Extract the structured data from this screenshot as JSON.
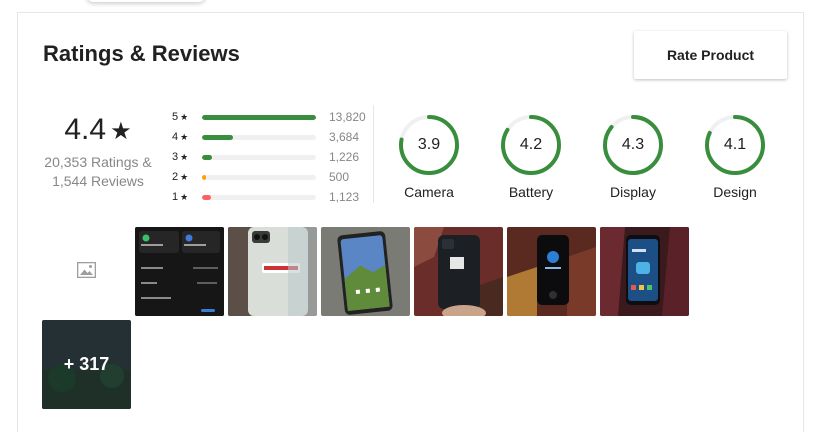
{
  "header": {
    "title": "Ratings & Reviews",
    "rate_button": "Rate Product"
  },
  "summary": {
    "average": "4.4",
    "star_glyph": "★",
    "ratings_text": "20,353 Ratings &",
    "reviews_text": "1,544 Reviews"
  },
  "distribution": [
    {
      "stars": "5",
      "count": "13,820",
      "fraction": 1.0,
      "color": "#388e3c"
    },
    {
      "stars": "4",
      "count": "3,684",
      "fraction": 0.27,
      "color": "#388e3c"
    },
    {
      "stars": "3",
      "count": "1,226",
      "fraction": 0.09,
      "color": "#388e3c"
    },
    {
      "stars": "2",
      "count": "500",
      "fraction": 0.036,
      "color": "#ff9f00"
    },
    {
      "stars": "1",
      "count": "1,123",
      "fraction": 0.081,
      "color": "#ff6161"
    }
  ],
  "features": [
    {
      "name": "Camera",
      "score": "3.9",
      "fraction": 0.78
    },
    {
      "name": "Battery",
      "score": "4.2",
      "fraction": 0.84
    },
    {
      "name": "Display",
      "score": "4.3",
      "fraction": 0.86
    },
    {
      "name": "Design",
      "score": "4.1",
      "fraction": 0.82
    }
  ],
  "colors": {
    "ring": "#388e3c",
    "ring_track": "#f0f0f0"
  },
  "gallery": {
    "icon": "image-icon",
    "more_label": "+ 317"
  }
}
